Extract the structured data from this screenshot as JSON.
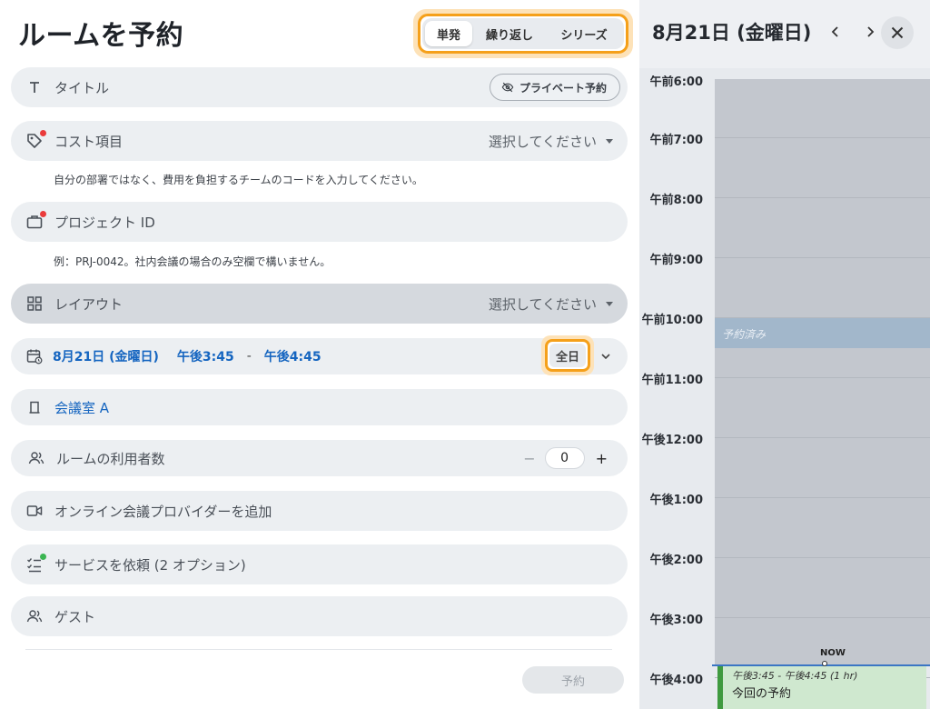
{
  "page": {
    "title": "ルームを予約"
  },
  "modes": {
    "items": [
      "単発",
      "繰り返し",
      "シリーズ"
    ],
    "active": "単発"
  },
  "form": {
    "title_label": "タイトル",
    "private_button": "プライベート予約",
    "cost": {
      "label": "コスト項目",
      "select": "選択してください",
      "hint": "自分の部署ではなく、費用を負担するチームのコードを入力してください。"
    },
    "project": {
      "label": "プロジェクト ID",
      "hint": "例：PRJ-0042。社内会議の場合のみ空欄で構いません。"
    },
    "layout": {
      "label": "レイアウト",
      "select": "選択してください"
    },
    "datetime": {
      "date": "8月21日 (金曜日)",
      "start": "午後3:45",
      "dash": "-",
      "end": "午後4:45",
      "allday": "全日"
    },
    "room": "会議室 A",
    "attendees": {
      "label": "ルームの利用者数",
      "minus": "−",
      "value": "0",
      "plus": "+"
    },
    "online": "オンライン会議プロバイダーを追加",
    "services": "サービスを依頼 (2 オプション)",
    "guests": "ゲスト",
    "book_button": "予約"
  },
  "calendar": {
    "date_title": "8月21日 (金曜日)",
    "prev": "‹",
    "next": "›",
    "close": "✕",
    "times": [
      "午前6:00",
      "午前7:00",
      "午前8:00",
      "午前9:00",
      "午前10:00",
      "午前11:00",
      "午後12:00",
      "午後1:00",
      "午後2:00",
      "午後3:00",
      "午後4:00"
    ],
    "booked_label": "予約済み",
    "now_label": "NOW",
    "event": {
      "time": "午後3:45 - 午後4:45 (1 hr)",
      "name": "今回の予約"
    },
    "colors": {
      "booked": "#a2b7cb",
      "event_bg": "#cfe8cf",
      "event_border": "#3f9a3f",
      "now_line": "#3b76c4"
    }
  },
  "colors": {
    "accent_ring": "#f5a01a",
    "link_blue": "#1565c0",
    "alert_dot": "#ea3b3b",
    "ok_dot": "#3bb552"
  }
}
